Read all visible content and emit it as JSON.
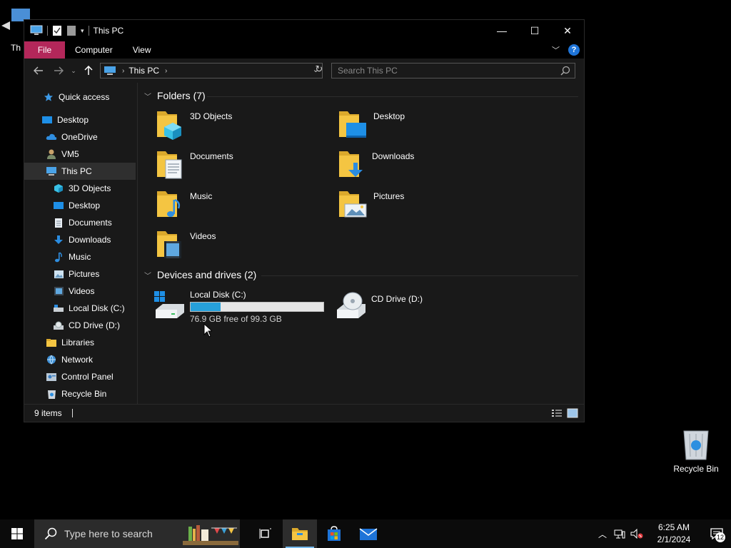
{
  "desktop": {
    "icons": [
      {
        "label": "This PC",
        "visible_text": "Th"
      },
      {
        "label": "Recycle Bin"
      }
    ]
  },
  "window": {
    "title": "This PC",
    "controls": {
      "minimize": "—",
      "maximize": "☐",
      "close": "✕"
    },
    "ribbon": {
      "tabs": [
        "File",
        "Computer",
        "View"
      ],
      "help": "?"
    },
    "address": {
      "crumb": "This PC"
    },
    "search": {
      "placeholder": "Search This PC"
    },
    "sidebar": {
      "items": [
        {
          "label": "Quick access",
          "icon": "star-icon"
        },
        {
          "label": "Desktop",
          "icon": "desktop-icon"
        },
        {
          "label": "OneDrive",
          "icon": "cloud-icon"
        },
        {
          "label": "VM5",
          "icon": "user-icon"
        },
        {
          "label": "This PC",
          "icon": "computer-icon",
          "selected": true
        },
        {
          "label": "3D Objects",
          "icon": "cube-icon"
        },
        {
          "label": "Desktop",
          "icon": "desktop-icon"
        },
        {
          "label": "Documents",
          "icon": "document-icon"
        },
        {
          "label": "Downloads",
          "icon": "download-icon"
        },
        {
          "label": "Music",
          "icon": "music-icon"
        },
        {
          "label": "Pictures",
          "icon": "picture-icon"
        },
        {
          "label": "Videos",
          "icon": "video-icon"
        },
        {
          "label": "Local Disk (C:)",
          "icon": "drive-icon"
        },
        {
          "label": "CD Drive (D:)",
          "icon": "cd-drive-icon"
        },
        {
          "label": "Libraries",
          "icon": "library-icon"
        },
        {
          "label": "Network",
          "icon": "network-icon"
        },
        {
          "label": "Control Panel",
          "icon": "control-panel-icon"
        },
        {
          "label": "Recycle Bin",
          "icon": "recycle-bin-icon"
        }
      ]
    },
    "folders_group": {
      "title": "Folders (7)",
      "items": [
        {
          "name": "3D Objects",
          "icon": "cube-icon"
        },
        {
          "name": "Desktop",
          "icon": "desktop-icon"
        },
        {
          "name": "Documents",
          "icon": "document-icon"
        },
        {
          "name": "Downloads",
          "icon": "download-icon"
        },
        {
          "name": "Music",
          "icon": "music-icon"
        },
        {
          "name": "Pictures",
          "icon": "picture-icon"
        },
        {
          "name": "Videos",
          "icon": "video-icon"
        }
      ]
    },
    "drives_group": {
      "title": "Devices and drives (2)",
      "items": [
        {
          "name": "Local Disk (C:)",
          "free_text": "76.9 GB free of 99.3 GB",
          "used_fraction": 0.226
        },
        {
          "name": "CD Drive (D:)"
        }
      ]
    },
    "status": {
      "count": "9 items"
    }
  },
  "taskbar": {
    "search_placeholder": "Type here to search",
    "clock": {
      "time": "6:25 AM",
      "date": "2/1/2024"
    },
    "notification_count": "12"
  },
  "colors": {
    "file_tab": "#b3275a",
    "accent": "#26a0da",
    "folder": "#f4c542"
  }
}
